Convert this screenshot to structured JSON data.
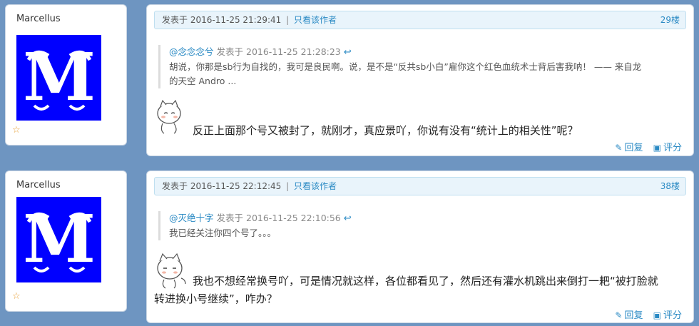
{
  "posts": [
    {
      "author": "Marcellus",
      "posted_prefix": "发表于",
      "posted_time": "2016-11-25 21:29:41",
      "only_author": "只看该作者",
      "floor": "29楼",
      "quote": {
        "user": "@念念念兮",
        "prefix": "发表于",
        "time": "2016-11-25 21:28:23",
        "line1": "胡说，你那是sb行为自找的，我可是良民啊。说，是不是“反共sb小白”雇你这个红色血统术士背后害我呐！ —— 来自龙",
        "line2": "的天空 Andro ..."
      },
      "content_line1": "反正上面那个号又被封了，就刚才，真应景吖，你说有没有“统计上的相关性”呢？",
      "content_line2": "",
      "reply_label": "回复",
      "rate_label": "评分"
    },
    {
      "author": "Marcellus",
      "posted_prefix": "发表于",
      "posted_time": "2016-11-25 22:12:45",
      "only_author": "只看该作者",
      "floor": "38楼",
      "quote": {
        "user": "@灭绝十字",
        "prefix": "发表于",
        "time": "2016-11-25 22:10:56",
        "line1": "我已经关注你四个号了。。。",
        "line2": ""
      },
      "content_line1": "我也不想经常换号吖，可是情况就这样，各位都看见了，然后还有灌水机跳出来倒打一耙“被打脸就",
      "content_line2": "转进换小号继续”，咋办？",
      "reply_label": "回复",
      "rate_label": "评分"
    }
  ],
  "icons": {
    "star": "star-icon",
    "reply": "reply-arrow-icon",
    "pencil": "pencil-icon",
    "rate": "rate-icon",
    "avatar": "letter-m-avatar"
  },
  "colors": {
    "page_bg": "#6e95c1",
    "link": "#2a8ac4",
    "avatar_bg": "#0000ff",
    "meta_bg": "#e9f4fb"
  }
}
